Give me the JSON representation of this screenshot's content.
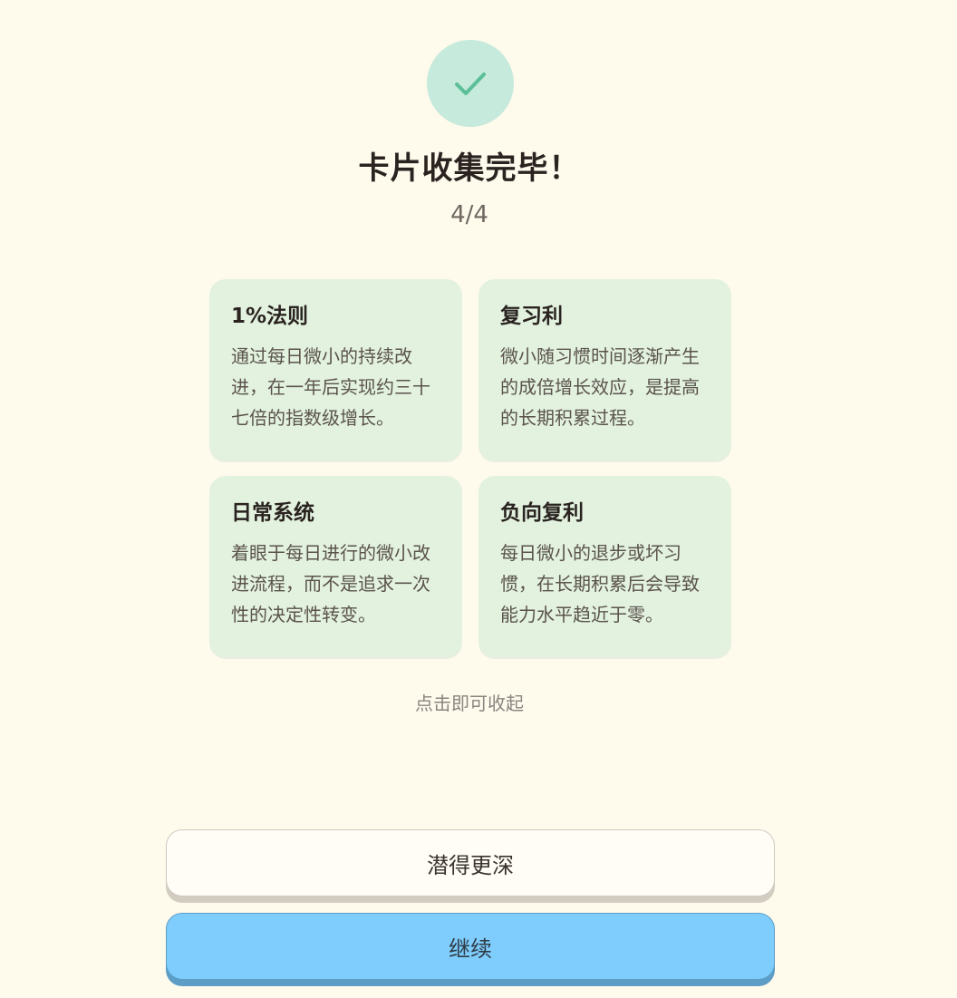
{
  "header": {
    "icon": "check-icon",
    "title": "卡片收集完毕！",
    "progress": "4/4"
  },
  "cards": [
    {
      "title": "1%法则",
      "text": "通过每日微小的持续改进，在一年后实现约三十七倍的指数级增长。"
    },
    {
      "title": "复习利",
      "text": "微小随习惯时间逐渐产生的成倍增长效应，是提高的长期积累过程。"
    },
    {
      "title": "日常系统",
      "text": "着眼于每日进行的微小改进流程，而不是追求一次性的决定性转变。"
    },
    {
      "title": "负向复利",
      "text": "每日微小的退步或坏习惯，在长期积累后会导致能力水平趋近于零。"
    }
  ],
  "collapse_hint": "点击即可收起",
  "buttons": {
    "deeper_label": "潜得更深",
    "continue_label": "继续"
  },
  "colors": {
    "background": "#fefaec",
    "check_circle": "#c6eadb",
    "check_mark": "#5bbf98",
    "card_background": "#e2f2df",
    "continue_button": "#7ecdfd"
  }
}
